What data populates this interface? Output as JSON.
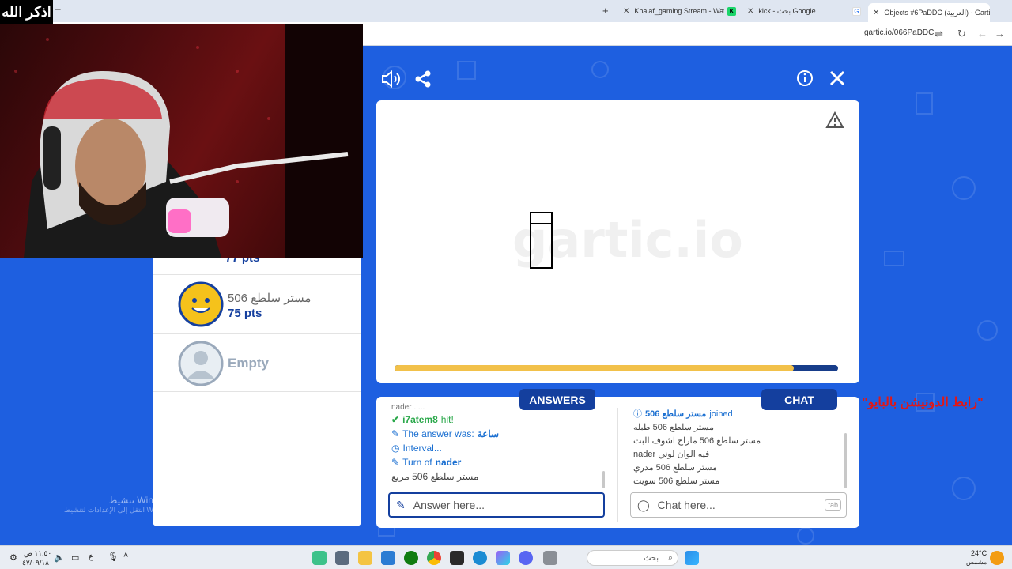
{
  "browser": {
    "tabs": [
      {
        "label": "Objects #6PaDDC (العربية) - Gartic",
        "active": true
      },
      {
        "label": "kick - بحث Google",
        "active": false
      },
      {
        "label": "Khalaf_gaming Stream - Watch",
        "active": false
      }
    ],
    "url": "gartic.io/066PaDDC"
  },
  "stream": {
    "corner_label": "اذكر الله",
    "donation_label": "\"رابط الدونيشن بالبايو\""
  },
  "game": {
    "watermark": "gartic.io",
    "progress": 0.9,
    "answers_tab": "ANSWERS",
    "chat_tab": "CHAT",
    "answers_log": [
      {
        "kind": "faded",
        "text": "nader ....."
      },
      {
        "kind": "hit",
        "name": "i7atem8",
        "text": "hit!"
      },
      {
        "kind": "answer",
        "prefix": "The answer was:",
        "word": "ساعة"
      },
      {
        "kind": "interval",
        "text": "Interval..."
      },
      {
        "kind": "turn",
        "prefix": "Turn of",
        "name": "nader"
      },
      {
        "kind": "guess",
        "text": "مستر سلطع 506 مربع"
      }
    ],
    "chat_log": [
      {
        "kind": "joined",
        "name": "مستر سلطع 506",
        "text": "joined"
      },
      {
        "kind": "msg",
        "text": "مستر سلطع 506 طبله"
      },
      {
        "kind": "msg",
        "text": "مستر سلطع 506 ماراح اشوف البث"
      },
      {
        "kind": "msg",
        "text": "nader فيه الوان لوني"
      },
      {
        "kind": "msg",
        "text": "مستر سلطع 506 مدري"
      },
      {
        "kind": "msg",
        "text": "مستر سلطع 506 سويت"
      }
    ],
    "answer_placeholder": "Answer here...",
    "chat_placeholder": "Chat here...",
    "chat_key_hint": "tab"
  },
  "players": [
    {
      "name": "مستر سلطع 506",
      "points": "75 pts",
      "partial_points": "77 pts"
    },
    {
      "name": "Empty"
    }
  ],
  "windows_activation": {
    "title": "تنشيط Windows",
    "subtitle": "انتقل إلى الإعدادات لتنشيط Windows"
  },
  "taskbar": {
    "search_placeholder": "بحث",
    "time": "١١:٥٠ ص",
    "date": "٤٧/٠٩/١٨",
    "temperature": "24°C",
    "weather": "مشمس",
    "lang": "ع"
  }
}
